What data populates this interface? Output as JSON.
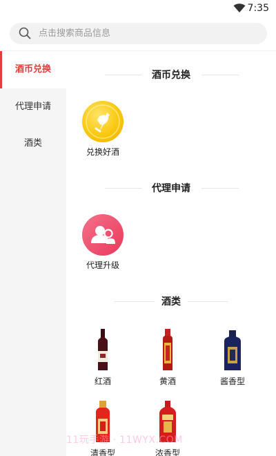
{
  "status_bar": {
    "time": "7:35",
    "wifi_icon": "wifi-icon"
  },
  "search": {
    "placeholder": "点击搜索商品信息",
    "icon": "search-icon"
  },
  "sidebar": {
    "items": [
      {
        "label": "酒币兑换",
        "active": true
      },
      {
        "label": "代理申请",
        "active": false
      },
      {
        "label": "酒类",
        "active": false
      }
    ]
  },
  "sections": [
    {
      "title": "酒币兑换",
      "items": [
        {
          "label": "兑换好酒",
          "icon": "coin-icon"
        }
      ]
    },
    {
      "title": "代理申请",
      "items": [
        {
          "label": "代理升级",
          "icon": "users-icon"
        }
      ]
    },
    {
      "title": "酒类",
      "items": [
        {
          "label": "红酒",
          "icon": "wine-bottle-icon"
        },
        {
          "label": "黄酒",
          "icon": "yellow-wine-bottle-icon"
        },
        {
          "label": "酱香型",
          "icon": "sauce-aroma-bottle-icon"
        },
        {
          "label": "清香型",
          "icon": "light-aroma-bottle-icon"
        },
        {
          "label": "浓香型",
          "icon": "strong-aroma-bottle-icon"
        }
      ]
    }
  ],
  "watermark": "11玩手游 · 11WYX.COM",
  "colors": {
    "accent": "#e83a36",
    "sidebar_bg": "#f5f5f5",
    "coin": "#f9c80e",
    "agent": "#e83a5a"
  }
}
